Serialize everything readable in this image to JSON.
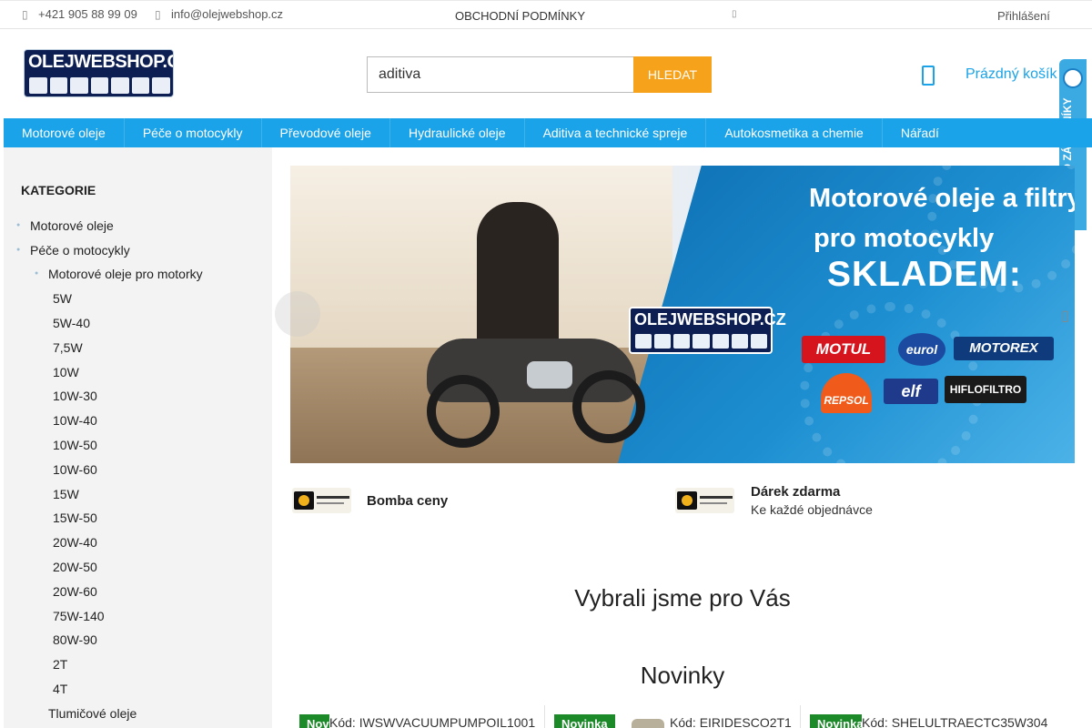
{
  "topbar": {
    "phone": "+421 905 88 99 09",
    "email": "info@olejwebshop.cz",
    "terms": "OBCHODNÍ PODMÍNKY",
    "login": "Přihlášení"
  },
  "header": {
    "logo_text": "OLEJWEBSHOP.CZ",
    "search_value": "aditiva",
    "search_button": "HLEDAT",
    "cart_label": "Prázdný košík",
    "badge_text": "OVĚŘENO ZÁKAZNÍKY"
  },
  "nav": [
    "Motorové oleje",
    "Péče o motocykly",
    "Převodové oleje",
    "Hydraulické oleje",
    "Aditiva a technické spreje",
    "Autokosmetika a chemie",
    "Nářadí"
  ],
  "sidebar": {
    "heading": "KATEGORIE",
    "level1": [
      "Motorové oleje",
      "Péče o motocykly"
    ],
    "level2": "Motorové oleje pro motorky",
    "viscosities": [
      "5W",
      "5W-40",
      "7,5W",
      "10W",
      "10W-30",
      "10W-40",
      "10W-50",
      "10W-60",
      "15W",
      "15W-50",
      "20W-40",
      "20W-50",
      "20W-60",
      "75W-140",
      "80W-90",
      "2T",
      "4T"
    ],
    "last": "Tlumičové oleje"
  },
  "banner": {
    "line1": "Motorové oleje a filtry",
    "line2": "pro motocykly",
    "line3": "SKLADEM:",
    "logo_text": "OLEJWEBSHOP.CZ",
    "brands": [
      "MOTUL",
      "eurol",
      "MOTOREX",
      "REPSOL",
      "elf",
      "HIFLOFILTRO"
    ],
    "colors": {
      "motul": "#d6141d",
      "eurol": "#1b4aa0",
      "motorex": "#0f3b7c",
      "repsol": "#f05a1a",
      "elf": "#1f3a8a",
      "hiflo": "#1a1a1a"
    }
  },
  "promo": {
    "item1_title": "Bomba ceny",
    "item2_title": "Dárek zdarma",
    "item2_sub": "Ke každé objednávce"
  },
  "sections": {
    "picked": "Vybrali jsme pro Vás",
    "new": "Novinky"
  },
  "products": [
    {
      "badge": "Novinka",
      "code": "Kód: IWSWVACUUMPUMPOIL1001"
    },
    {
      "badge": "Novinka",
      "code": "Kód: EIRIDESCO2T1"
    },
    {
      "badge": "Novinka",
      "code": "Kód: SHELULTRAECTC35W304"
    }
  ],
  "colors": {
    "accent": "#1aa3e8",
    "search_button": "#f7a21b",
    "new_badge": "#1d8a2a"
  }
}
